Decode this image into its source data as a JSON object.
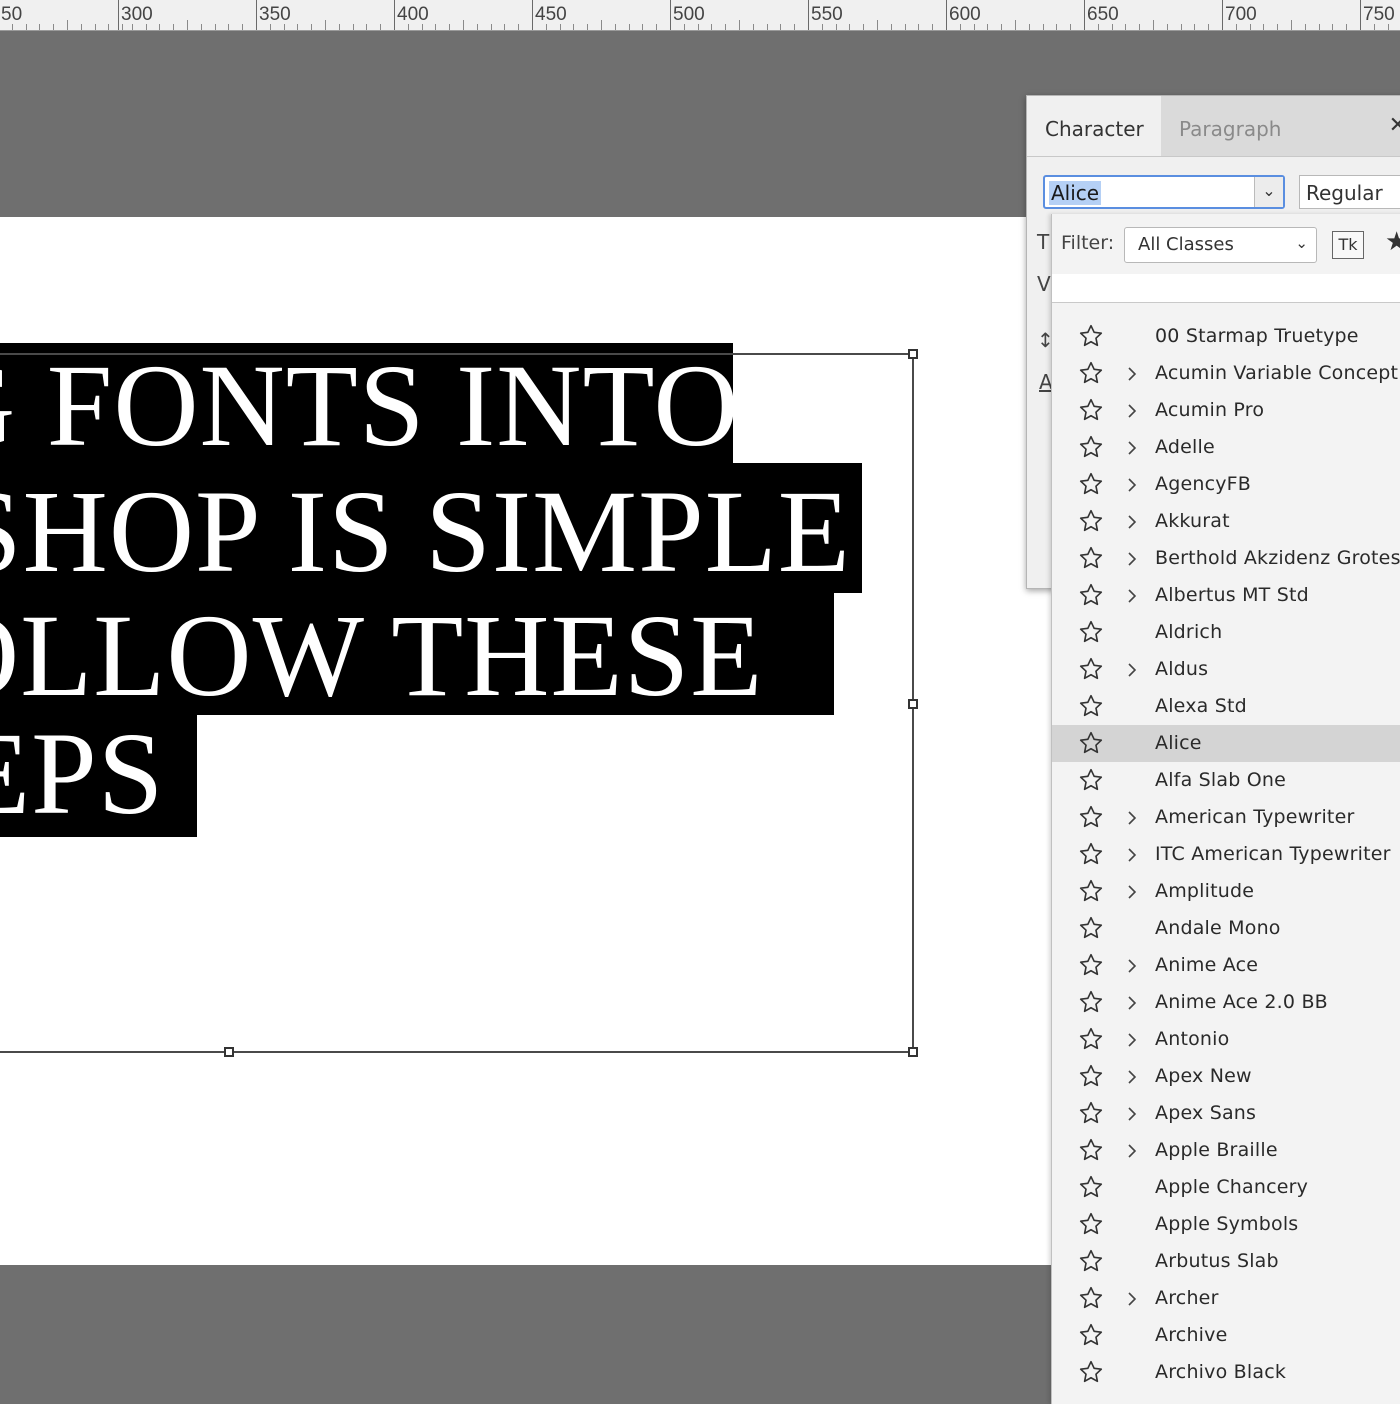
{
  "ruler": {
    "labels": [
      "50",
      "300",
      "350",
      "400",
      "450",
      "500",
      "550",
      "600",
      "650",
      "700",
      "750"
    ]
  },
  "headline": {
    "lines": [
      "G FONTS INTO",
      "SHOP IS SIMPLE",
      "OLLOW THESE",
      "EPS"
    ]
  },
  "panel": {
    "tabs": [
      "Character",
      "Paragraph"
    ],
    "close_icon": "close-icon",
    "font_family_value": "Alice",
    "font_style_value": "Regular",
    "side_glyphs": [
      "V",
      "A"
    ]
  },
  "font_list": {
    "filter_label": "Filter:",
    "filter_value": "All Classes",
    "typekit_label": "Tk",
    "fonts": [
      {
        "name": "00 Starmap Truetype",
        "expandable": false,
        "selected": false
      },
      {
        "name": "Acumin Variable Concept",
        "expandable": true,
        "selected": false
      },
      {
        "name": "Acumin Pro",
        "expandable": true,
        "selected": false
      },
      {
        "name": "Adelle",
        "expandable": true,
        "selected": false
      },
      {
        "name": "AgencyFB",
        "expandable": true,
        "selected": false
      },
      {
        "name": "Akkurat",
        "expandable": true,
        "selected": false
      },
      {
        "name": "Berthold Akzidenz Grotesk",
        "expandable": true,
        "selected": false
      },
      {
        "name": "Albertus MT Std",
        "expandable": true,
        "selected": false
      },
      {
        "name": "Aldrich",
        "expandable": false,
        "selected": false
      },
      {
        "name": "Aldus",
        "expandable": true,
        "selected": false
      },
      {
        "name": "Alexa Std",
        "expandable": false,
        "selected": false
      },
      {
        "name": "Alice",
        "expandable": false,
        "selected": true
      },
      {
        "name": "Alfa Slab One",
        "expandable": false,
        "selected": false
      },
      {
        "name": "American Typewriter",
        "expandable": true,
        "selected": false
      },
      {
        "name": "ITC American Typewriter",
        "expandable": true,
        "selected": false
      },
      {
        "name": "Amplitude",
        "expandable": true,
        "selected": false
      },
      {
        "name": "Andale Mono",
        "expandable": false,
        "selected": false
      },
      {
        "name": "Anime Ace",
        "expandable": true,
        "selected": false
      },
      {
        "name": "Anime Ace 2.0 BB",
        "expandable": true,
        "selected": false
      },
      {
        "name": "Antonio",
        "expandable": true,
        "selected": false
      },
      {
        "name": "Apex New",
        "expandable": true,
        "selected": false
      },
      {
        "name": "Apex Sans",
        "expandable": true,
        "selected": false
      },
      {
        "name": "Apple Braille",
        "expandable": true,
        "selected": false
      },
      {
        "name": "Apple Chancery",
        "expandable": false,
        "selected": false
      },
      {
        "name": "Apple Symbols",
        "expandable": false,
        "selected": false
      },
      {
        "name": "Arbutus Slab",
        "expandable": false,
        "selected": false
      },
      {
        "name": "Archer",
        "expandable": true,
        "selected": false
      },
      {
        "name": "Archive",
        "expandable": false,
        "selected": false
      },
      {
        "name": "Archivo Black",
        "expandable": false,
        "selected": false
      }
    ]
  },
  "colors": {
    "workspace": "#6f6f6f",
    "canvas": "#ffffff",
    "highlight": "#000000",
    "selection_blue": "#5a8ee0",
    "selected_row": "#d4d4d4"
  }
}
